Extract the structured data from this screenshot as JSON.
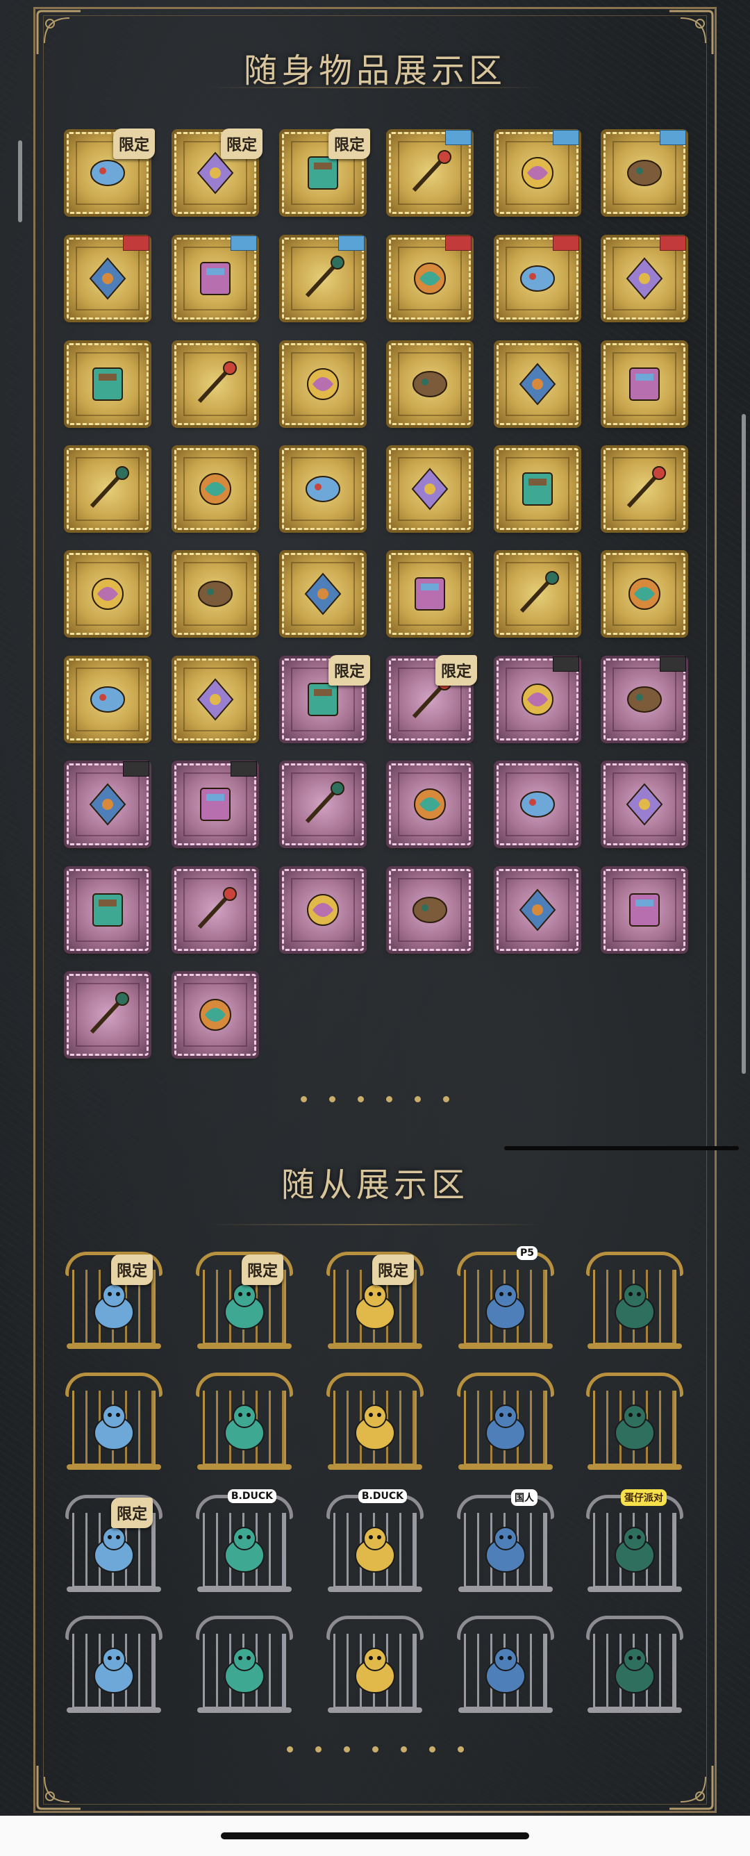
{
  "sections": {
    "items_title": "随身物品展示区",
    "pets_title": "随从展示区"
  },
  "badge_text": "限定",
  "items": [
    {
      "tier": "gold",
      "icon": "mask-ornament-icon",
      "badge": "限定"
    },
    {
      "tier": "gold",
      "icon": "crystal-mask-icon",
      "badge": "限定"
    },
    {
      "tier": "gold",
      "icon": "teal-dragon-icon",
      "badge": "限定"
    },
    {
      "tier": "gold",
      "icon": "blue-pendant-icon",
      "tag": "blue"
    },
    {
      "tier": "gold",
      "icon": "mechanical-bird-icon",
      "tag": "blue"
    },
    {
      "tier": "gold",
      "icon": "ornate-ring-icon",
      "tag": "blue"
    },
    {
      "tier": "gold",
      "icon": "red-shrine-icon",
      "tag": "red"
    },
    {
      "tier": "gold",
      "icon": "sword-icon",
      "tag": "blue"
    },
    {
      "tier": "gold",
      "icon": "spellbook-icon",
      "tag": "blue"
    },
    {
      "tier": "gold",
      "icon": "golden-key-icon",
      "tag": "red"
    },
    {
      "tier": "gold",
      "icon": "silver-mask-icon",
      "tag": "red"
    },
    {
      "tier": "gold",
      "icon": "flower-staff-icon",
      "tag": "red"
    },
    {
      "tier": "gold",
      "icon": "scythe-icon"
    },
    {
      "tier": "gold",
      "icon": "treasure-chest-icon"
    },
    {
      "tier": "gold",
      "icon": "crystal-staff-icon"
    },
    {
      "tier": "gold",
      "icon": "scroll-icon"
    },
    {
      "tier": "gold",
      "icon": "blue-rose-icon"
    },
    {
      "tier": "gold",
      "icon": "blue-ribbon-icon"
    },
    {
      "tier": "gold",
      "icon": "masquerade-mask-icon"
    },
    {
      "tier": "gold",
      "icon": "purple-orb-icon"
    },
    {
      "tier": "gold",
      "icon": "purple-tome-icon"
    },
    {
      "tier": "gold",
      "icon": "dark-book-icon"
    },
    {
      "tier": "gold",
      "icon": "owl-emblem-icon"
    },
    {
      "tier": "gold",
      "icon": "golden-bird-icon"
    },
    {
      "tier": "gold",
      "icon": "purple-crystal-icon"
    },
    {
      "tier": "gold",
      "icon": "wooden-club-icon"
    },
    {
      "tier": "gold",
      "icon": "blue-gem-cluster-icon"
    },
    {
      "tier": "gold",
      "icon": "golden-bell-icon"
    },
    {
      "tier": "gold",
      "icon": "ballerina-icon"
    },
    {
      "tier": "gold",
      "icon": "ice-flower-icon"
    },
    {
      "tier": "gold",
      "icon": "bone-wing-icon"
    },
    {
      "tier": "gold",
      "icon": "phoenix-icon"
    },
    {
      "tier": "purple",
      "icon": "golden-dagger-icon",
      "badge": "限定"
    },
    {
      "tier": "purple",
      "icon": "quill-ink-icon",
      "badge": "限定"
    },
    {
      "tier": "purple",
      "icon": "music-box-icon",
      "tag": "dark"
    },
    {
      "tier": "purple",
      "icon": "camera-icon",
      "tag": "dark"
    },
    {
      "tier": "purple",
      "icon": "bandage-roll-icon",
      "tag": "dark"
    },
    {
      "tier": "purple",
      "icon": "black-box-icon",
      "tag": "dark"
    },
    {
      "tier": "purple",
      "icon": "green-notebook-icon"
    },
    {
      "tier": "purple",
      "icon": "parchment-feather-icon"
    },
    {
      "tier": "purple",
      "icon": "blue-flower-wand-icon"
    },
    {
      "tier": "purple",
      "icon": "gear-globe-icon"
    },
    {
      "tier": "purple",
      "icon": "golden-trophy-icon"
    },
    {
      "tier": "purple",
      "icon": "feather-blade-icon"
    },
    {
      "tier": "purple",
      "icon": "golden-scepter-icon"
    },
    {
      "tier": "purple",
      "icon": "green-book-icon"
    },
    {
      "tier": "purple",
      "icon": "message-bottle-icon"
    },
    {
      "tier": "purple",
      "icon": "bronze-kettle-icon"
    },
    {
      "tier": "purple",
      "icon": "jade-dagger-icon"
    },
    {
      "tier": "purple",
      "icon": "antler-ornament-icon"
    }
  ],
  "pets": [
    {
      "cage": "gold",
      "icon": "caged-harlequin-icon",
      "badge": "限定"
    },
    {
      "cage": "gold",
      "icon": "caged-blue-creature-icon",
      "badge": "限定"
    },
    {
      "cage": "gold",
      "icon": "caged-music-box-icon",
      "badge": "限定"
    },
    {
      "cage": "gold",
      "icon": "caged-robot-cat-icon",
      "label": "P5"
    },
    {
      "cage": "gold",
      "icon": "caged-steam-engine-icon"
    },
    {
      "cage": "gold",
      "icon": "caged-dark-dragon-icon"
    },
    {
      "cage": "gold",
      "icon": "caged-vampire-icon"
    },
    {
      "cage": "gold",
      "icon": "caged-jellyfish-icon"
    },
    {
      "cage": "gold",
      "icon": "caged-silver-bird-icon"
    },
    {
      "cage": "gold",
      "icon": "caged-crystal-globe-icon"
    },
    {
      "cage": "silver",
      "icon": "caged-teal-spirit-icon",
      "badge": "限定"
    },
    {
      "cage": "silver",
      "icon": "caged-yellow-duck-icon",
      "label": "B.DUCK"
    },
    {
      "cage": "silver",
      "icon": "caged-black-duck-icon",
      "label": "B.DUCK"
    },
    {
      "cage": "silver",
      "icon": "caged-teal-cat-icon",
      "label": "国人"
    },
    {
      "cage": "silver",
      "icon": "caged-yellow-toy-icon",
      "label": "蛋仔派对",
      "label_style": "yellow"
    },
    {
      "cage": "silver",
      "icon": "caged-bat-owl-icon"
    },
    {
      "cage": "silver",
      "icon": "caged-reindeer-icon"
    },
    {
      "cage": "silver",
      "icon": "caged-raccoon-icon"
    },
    {
      "cage": "silver",
      "icon": "caged-lantern-icon"
    },
    {
      "cage": "silver",
      "icon": "caged-crowned-cat-icon"
    }
  ],
  "pagination": {
    "items_dots": 6,
    "pets_dots": 7
  }
}
